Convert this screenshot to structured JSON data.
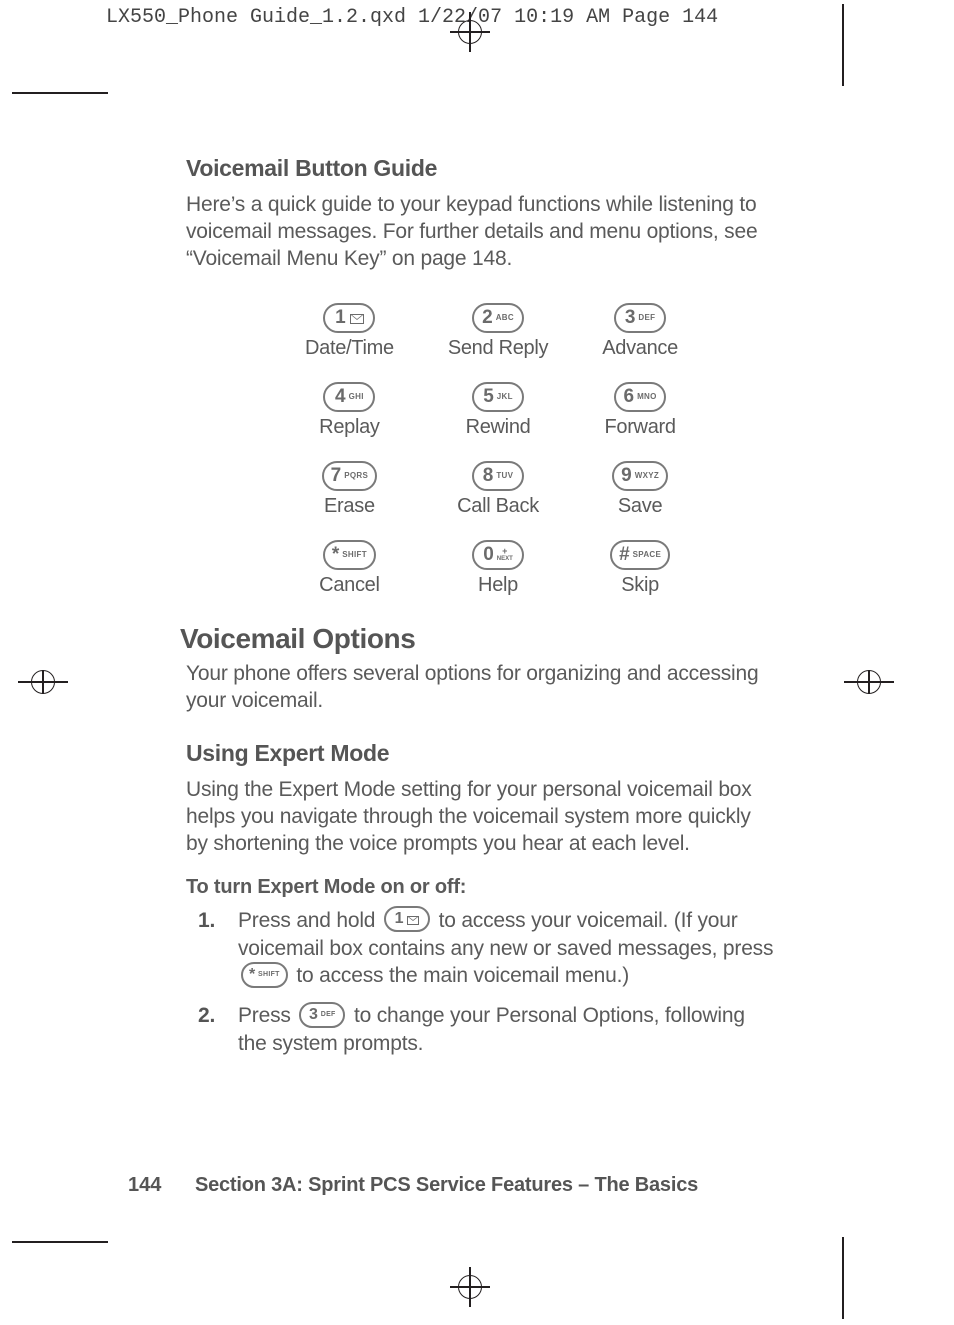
{
  "meta_header": "LX550_Phone Guide_1.2.qxd  1/22/07  10:19 AM  Page 144",
  "section1": {
    "heading": "Voicemail Button Guide",
    "paragraph": "Here’s a quick guide to your keypad functions while listening to voicemail messages. For further details and menu options, see “Voicemail Menu Key” on page 148."
  },
  "keypad": [
    {
      "digit": "1",
      "sub": "",
      "icon": "envelope",
      "label": "Date/Time"
    },
    {
      "digit": "2",
      "sub": "ABC",
      "icon": "",
      "label": "Send Reply"
    },
    {
      "digit": "3",
      "sub": "DEF",
      "icon": "",
      "label": "Advance"
    },
    {
      "digit": "4",
      "sub": "GHI",
      "icon": "",
      "label": "Replay"
    },
    {
      "digit": "5",
      "sub": "JKL",
      "icon": "",
      "label": "Rewind"
    },
    {
      "digit": "6",
      "sub": "MNO",
      "icon": "",
      "label": "Forward"
    },
    {
      "digit": "7",
      "sub": "PQRS",
      "icon": "",
      "label": "Erase"
    },
    {
      "digit": "8",
      "sub": "TUV",
      "icon": "",
      "label": "Call Back"
    },
    {
      "digit": "9",
      "sub": "WXYZ",
      "icon": "",
      "label": "Save"
    },
    {
      "digit": "*",
      "sub": "SHIFT",
      "icon": "",
      "label": "Cancel"
    },
    {
      "digit": "0",
      "sub": "+",
      "sub2": "NEXT",
      "icon": "",
      "label": "Help"
    },
    {
      "digit": "#",
      "sub": "SPACE",
      "icon": "",
      "label": "Skip"
    }
  ],
  "section2": {
    "heading": "Voicemail Options",
    "paragraph": "Your phone offers several options for organizing and accessing your voicemail."
  },
  "section3": {
    "heading": "Using Expert Mode",
    "paragraph": "Using the Expert Mode setting for your personal voicemail box helps you navigate through the voicemail system more quickly by shortening the voice prompts you hear at each level.",
    "directive": "To turn Expert Mode on or off:",
    "steps": {
      "s1a": "Press and hold ",
      "s1b": " to access your voicemail. (If your voicemail box contains any new or saved messages, press ",
      "s1c": " to access the main voicemail menu.)",
      "s2a": "Press ",
      "s2b": " to change your Personal Options, following the system prompts."
    },
    "inline_keys": {
      "k1": {
        "digit": "1",
        "sub": "",
        "icon": "envelope"
      },
      "kstar": {
        "digit": "*",
        "sub": "SHIFT",
        "icon": ""
      },
      "k3": {
        "digit": "3",
        "sub": "DEF",
        "icon": ""
      }
    }
  },
  "footer": {
    "page_number": "144",
    "text": "Section 3A: Sprint PCS Service Features – The Basics"
  }
}
